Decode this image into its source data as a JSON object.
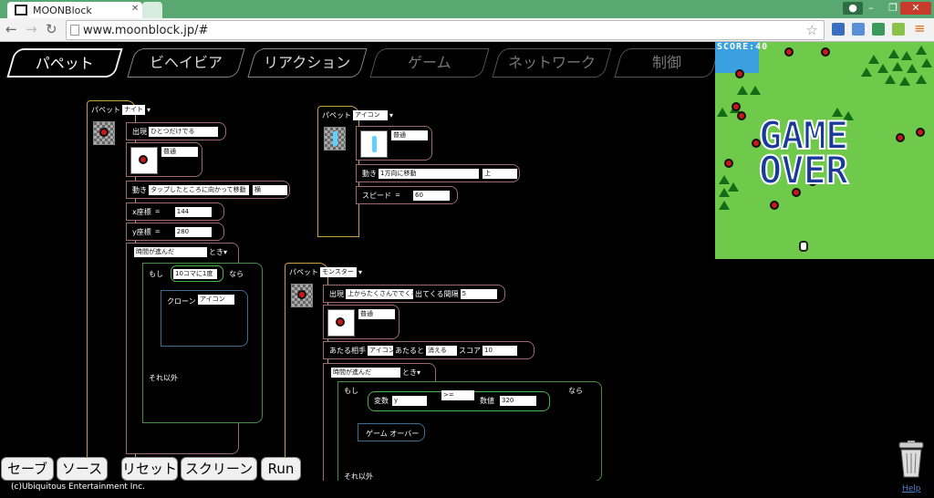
{
  "browser": {
    "tab_title": "MOONBlock",
    "url": "www.moonblock.jp/#"
  },
  "editor_tabs": [
    "パペット",
    "ビヘイビア",
    "リアクション",
    "ゲーム",
    "ネットワーク",
    "制御"
  ],
  "block1": {
    "header_label": "パペット",
    "puppet_name": "ナイト",
    "appear_label": "出現",
    "appear_value": "ひとつだけでる",
    "image_value": "普通",
    "move_label": "動き",
    "move_value": "タップしたところに向かって移動",
    "move_dir": "横",
    "x_label": "x座標",
    "x_eq": "=",
    "x_value": "144",
    "y_label": "y座標",
    "y_eq": "=",
    "y_value": "280",
    "timer_value": "時間が進んだ",
    "timer_suffix": "とき",
    "if_label": "もし",
    "if_value": "10コマに1度",
    "then_label": "なら",
    "clone_label": "クローン",
    "clone_value": "アイコン",
    "else_label": "それ以外"
  },
  "block2": {
    "header_label": "パペット",
    "puppet_name": "アイコン",
    "image_value": "普通",
    "move_label": "動き",
    "move_value": "1方向に移動",
    "move_dir": "上",
    "speed_label": "スピード",
    "speed_eq": "=",
    "speed_value": "60"
  },
  "block3": {
    "header_label": "パペット",
    "puppet_name": "モンスター",
    "appear_label": "出現",
    "appear_value": "上からたくさんででくる",
    "interval_label": "出てくる間隔",
    "interval_value": "5",
    "image_value": "普通",
    "hit_label": "あたる相手",
    "hit_target": "アイコン",
    "hit_when": "あたると",
    "hit_action": "消える",
    "score_label": "スコア",
    "score_value": "10",
    "timer_value": "時間が進んだ",
    "timer_suffix": "とき",
    "if_label": "もし",
    "var_label": "変数",
    "var_value": "y",
    "op_value": ">=",
    "num_label": "数値",
    "num_value": "320",
    "then_label": "なら",
    "gameover_label": "ゲーム オーバー",
    "else_label": "それ以外"
  },
  "game_screen": {
    "score_label": "SCORE:",
    "score_value": "40",
    "gameover_line1": "GAME",
    "gameover_line2": "OVER"
  },
  "bottom_buttons": [
    "セーブ",
    "ソース",
    "リセット",
    "スクリーン",
    "Run"
  ],
  "footer": {
    "copyright": "(c)Ubiquitous Entertainment Inc.",
    "help": "Help"
  },
  "colors": {
    "chrome": "#59a871",
    "block_border": "#c9942a",
    "game_bg": "#6fc94a",
    "gameover": "#1a3a9a"
  }
}
